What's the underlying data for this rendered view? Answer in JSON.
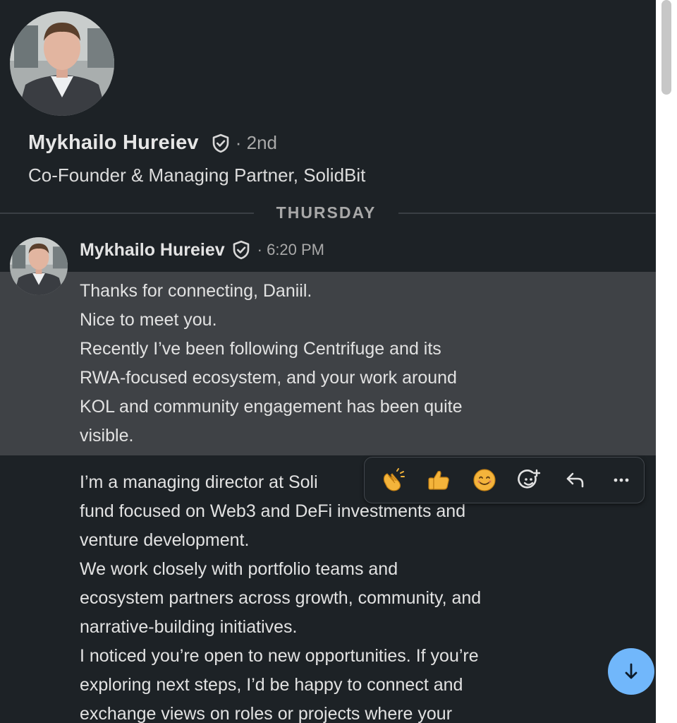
{
  "profile": {
    "name": "Mykhailo Hureiev",
    "degree": "· 2nd",
    "headline": "Co-Founder & Managing Partner, SolidBit"
  },
  "conversation": {
    "day_divider": "THURSDAY",
    "message": {
      "sender": "Mykhailo Hureiev",
      "time": "· 6:20 PM",
      "highlighted_lines": [
        "Thanks for connecting, Daniil.",
        "Nice to meet you.",
        "Recently I’ve been following Centrifuge and its",
        "RWA-focused ecosystem, and your work around",
        "KOL and community engagement has been quite",
        "visible."
      ],
      "lines": [
        "I’m a managing director at Soli",
        "fund focused on Web3 and DeFi investments and",
        "venture development.",
        "We work closely with portfolio teams and",
        "ecosystem partners across growth, community, and",
        "narrative-building initiatives.",
        "I noticed you’re open to new opportunities. If you’re",
        "exploring next steps, I’d be happy to connect and",
        "exchange views on roles or projects where your"
      ]
    }
  },
  "reactions": {
    "icons": [
      "clapping-hands-icon",
      "thumbs-up-icon",
      "smiling-face-icon",
      "add-reaction-icon",
      "reply-icon",
      "more-options-icon"
    ]
  },
  "colors": {
    "background": "#1d2226",
    "highlight": "#3f4246",
    "accent": "#71b7fb",
    "scrollbar_track": "#ffffff"
  }
}
